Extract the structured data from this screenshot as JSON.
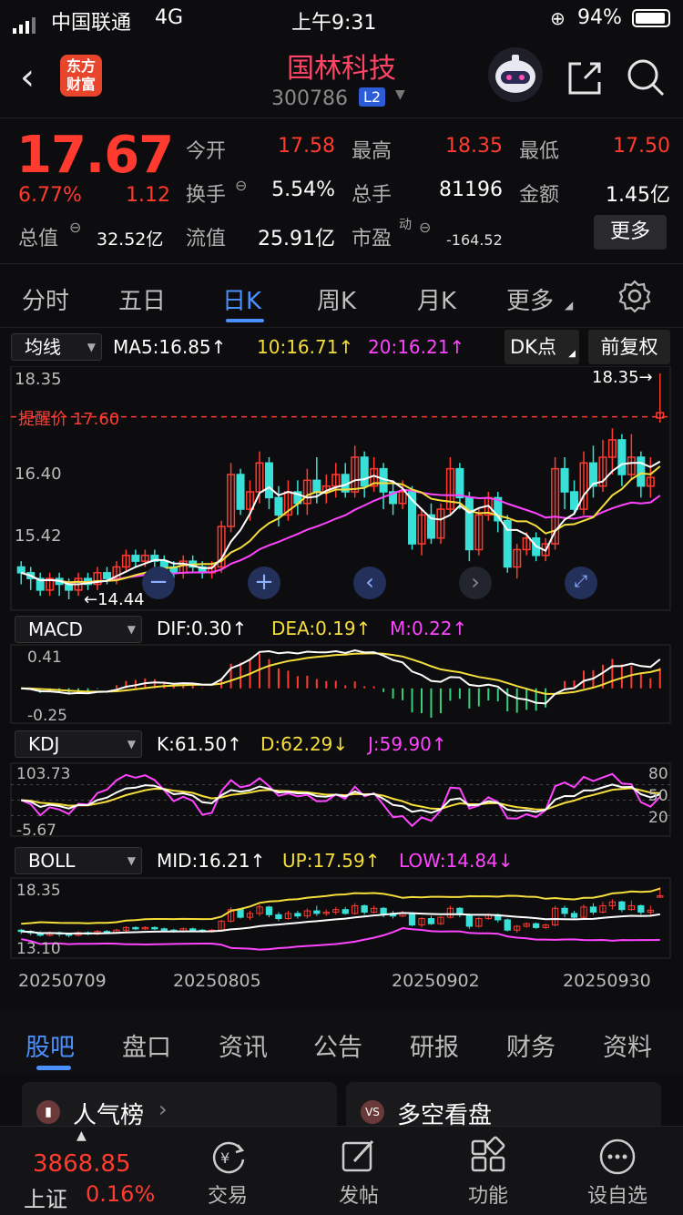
{
  "status": {
    "carrier": "中国联通",
    "network": "4G",
    "time": "上午9:31",
    "battery": "94%"
  },
  "header": {
    "title": "国林科技",
    "code": "300786",
    "level": "L2",
    "logo_line1": "东方",
    "logo_line2": "财富"
  },
  "quote": {
    "price": "17.67",
    "pct": "6.77%",
    "change": "1.12",
    "open_label": "今开",
    "open": "17.58",
    "high_label": "最高",
    "high": "18.35",
    "low_label": "最低",
    "low": "17.50",
    "turnover_label": "换手",
    "turnover": "5.54%",
    "volume_label": "总手",
    "volume": "81196",
    "amount_label": "金额",
    "amount": "1.45亿",
    "total_cap_label": "总值",
    "total_cap": "32.52亿",
    "float_cap_label": "流值",
    "float_cap": "25.91亿",
    "pe_label": "市盈",
    "pe_sup": "动",
    "pe": "-164.52",
    "more_button": "更多"
  },
  "tabs": [
    "分时",
    "五日",
    "日K",
    "周K",
    "月K",
    "更多"
  ],
  "active_tab": "日K",
  "ma": {
    "selector": "均线",
    "ma5": "MA5:16.85",
    "ma10": "10:16.71",
    "ma20": "20:16.21",
    "dk": "DK点",
    "adjust": "前复权"
  },
  "kchart": {
    "y_top": "18.35",
    "y_mid": "16.40",
    "y_low": "15.42",
    "y_bot": "14.44",
    "remind": "提醒价 17.60",
    "max_marker": "18.35→",
    "min_marker": "14.44"
  },
  "macd": {
    "selector": "MACD",
    "dif": "DIF:0.30",
    "dea": "DEA:0.19",
    "m": "M:0.22",
    "y_top": "0.41",
    "y_bot": "-0.25"
  },
  "kdj": {
    "selector": "KDJ",
    "k": "K:61.50",
    "d": "D:62.29",
    "j": "J:59.90",
    "y_top": "103.73",
    "y_bot": "-5.67",
    "r80": "80",
    "r50": "50",
    "r20": "20"
  },
  "boll": {
    "selector": "BOLL",
    "mid": "MID:16.21",
    "up": "UP:17.59",
    "low": "LOW:14.84",
    "y_top": "18.35",
    "y_bot": "13.10"
  },
  "dates": [
    "20250709",
    "20250805",
    "20250902",
    "20250930"
  ],
  "subtabs": [
    "股吧",
    "盘口",
    "资讯",
    "公告",
    "研报",
    "财务",
    "资料"
  ],
  "cards": [
    "人气榜",
    "多空看盘"
  ],
  "index": {
    "value": "3868.85",
    "name": "上证",
    "pct": "0.16%"
  },
  "nav": [
    "交易",
    "发帖",
    "功能",
    "设自选"
  ],
  "colors": {
    "up": "#ff3b30",
    "down": "#38e0d8",
    "accent": "#4a90ff",
    "yellow": "#f5dd3c",
    "magenta": "#ff44ff"
  },
  "chart_data": {
    "type": "candlestick",
    "title": "",
    "indicators": [
      "MA5",
      "MA10",
      "MA20",
      "MACD",
      "KDJ",
      "BOLL"
    ],
    "ohlc": [
      [
        15.0,
        14.9,
        15.1,
        14.7
      ],
      [
        14.9,
        14.8,
        15.0,
        14.6
      ],
      [
        14.8,
        14.6,
        14.9,
        14.5
      ],
      [
        14.6,
        14.8,
        14.9,
        14.5
      ],
      [
        14.8,
        14.7,
        14.9,
        14.5
      ],
      [
        14.7,
        14.6,
        14.8,
        14.44
      ],
      [
        14.6,
        14.8,
        14.9,
        14.5
      ],
      [
        14.8,
        14.7,
        14.9,
        14.6
      ],
      [
        14.7,
        14.9,
        15.0,
        14.6
      ],
      [
        14.9,
        14.8,
        15.0,
        14.7
      ],
      [
        14.8,
        15.0,
        15.1,
        14.7
      ],
      [
        15.0,
        15.2,
        15.3,
        14.9
      ],
      [
        15.2,
        15.1,
        15.3,
        15.0
      ],
      [
        15.1,
        15.2,
        15.3,
        15.0
      ],
      [
        15.2,
        15.1,
        15.3,
        15.0
      ],
      [
        15.1,
        15.0,
        15.2,
        14.9
      ],
      [
        15.0,
        14.9,
        15.1,
        14.8
      ],
      [
        14.9,
        15.1,
        15.2,
        14.8
      ],
      [
        15.1,
        15.0,
        15.2,
        14.9
      ],
      [
        15.0,
        14.9,
        15.1,
        14.8
      ],
      [
        14.9,
        15.0,
        15.1,
        14.8
      ],
      [
        15.0,
        15.7,
        15.8,
        14.9
      ],
      [
        15.7,
        16.6,
        16.8,
        15.6
      ],
      [
        16.6,
        16.0,
        16.7,
        15.9
      ],
      [
        16.0,
        16.3,
        16.5,
        15.8
      ],
      [
        16.3,
        16.8,
        17.0,
        16.1
      ],
      [
        16.8,
        16.2,
        16.9,
        16.0
      ],
      [
        16.2,
        15.9,
        16.4,
        15.7
      ],
      [
        15.9,
        16.3,
        16.5,
        15.8
      ],
      [
        16.3,
        16.1,
        16.5,
        15.9
      ],
      [
        16.1,
        16.5,
        16.7,
        15.9
      ],
      [
        16.5,
        16.3,
        16.9,
        16.1
      ],
      [
        16.3,
        16.4,
        16.6,
        16.1
      ],
      [
        16.4,
        16.6,
        16.8,
        16.2
      ],
      [
        16.6,
        16.3,
        16.8,
        16.2
      ],
      [
        16.3,
        16.9,
        17.1,
        16.2
      ],
      [
        16.9,
        16.4,
        17.0,
        16.2
      ],
      [
        16.4,
        16.7,
        16.9,
        16.3
      ],
      [
        16.7,
        16.3,
        16.8,
        16.0
      ],
      [
        16.3,
        16.1,
        16.5,
        15.9
      ],
      [
        16.1,
        16.3,
        16.5,
        16.0
      ],
      [
        16.3,
        15.4,
        16.4,
        15.3
      ],
      [
        15.4,
        15.9,
        16.0,
        15.2
      ],
      [
        15.9,
        15.5,
        16.1,
        15.4
      ],
      [
        15.5,
        16.0,
        16.1,
        15.4
      ],
      [
        16.0,
        16.7,
        16.9,
        15.9
      ],
      [
        16.7,
        16.2,
        16.8,
        16.0
      ],
      [
        16.2,
        15.3,
        16.3,
        15.1
      ],
      [
        15.3,
        15.9,
        16.0,
        15.2
      ],
      [
        15.9,
        16.2,
        16.3,
        15.8
      ],
      [
        16.2,
        15.8,
        16.3,
        15.6
      ],
      [
        15.8,
        15.0,
        15.9,
        14.9
      ],
      [
        15.0,
        15.3,
        15.4,
        14.8
      ],
      [
        15.3,
        15.5,
        15.6,
        15.2
      ],
      [
        15.5,
        15.2,
        15.6,
        15.1
      ],
      [
        15.2,
        15.4,
        15.5,
        15.1
      ],
      [
        15.4,
        16.7,
        16.9,
        15.3
      ],
      [
        16.7,
        16.3,
        16.9,
        16.0
      ],
      [
        16.3,
        16.0,
        16.5,
        15.9
      ],
      [
        16.0,
        16.8,
        17.0,
        15.9
      ],
      [
        16.8,
        16.4,
        17.1,
        16.2
      ],
      [
        16.4,
        16.9,
        17.2,
        16.3
      ],
      [
        16.9,
        17.2,
        17.4,
        16.6
      ],
      [
        17.2,
        16.6,
        17.3,
        16.4
      ],
      [
        16.6,
        16.9,
        17.3,
        16.5
      ],
      [
        16.9,
        16.4,
        17.0,
        16.2
      ],
      [
        16.4,
        16.55,
        16.9,
        16.2
      ],
      [
        17.58,
        17.67,
        18.35,
        17.5
      ]
    ]
  }
}
